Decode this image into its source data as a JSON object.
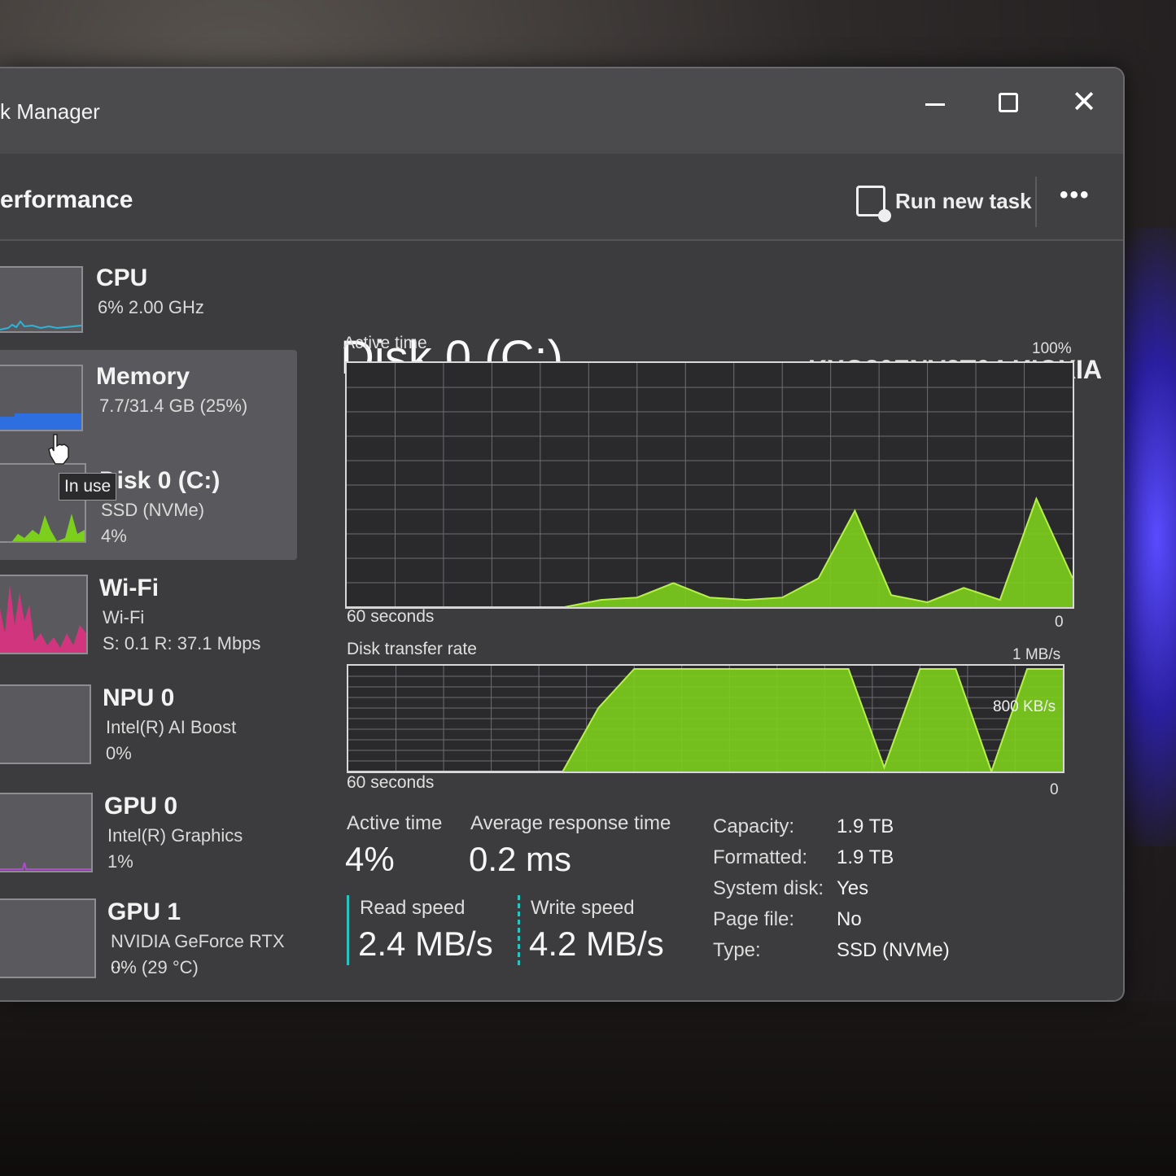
{
  "window": {
    "title": "k Manager"
  },
  "titlebar_buttons": {
    "minimize": "minimize-icon",
    "maximize": "maximize-icon",
    "close": "✕"
  },
  "command_bar": {
    "page": "erformance",
    "run_task": "Run new task",
    "more": "•••"
  },
  "sidebar": {
    "items": [
      {
        "name": "CPU",
        "line1": "6% 2.00 GHz",
        "line2": "",
        "color": "#2fb3d8"
      },
      {
        "name": "Memory",
        "line1": "7.7/31.4 GB (25%)",
        "line2": "",
        "color": "#2d6fe0"
      },
      {
        "name": "Disk 0 (C:)",
        "line1": "SSD (NVMe)",
        "line2": "4%",
        "color": "#7ccf1c"
      },
      {
        "name": "Wi-Fi",
        "line1": "Wi-Fi",
        "line2": "S: 0.1 R: 37.1 Mbps",
        "color": "#d0357d"
      },
      {
        "name": "NPU 0",
        "line1": "Intel(R) AI Boost",
        "line2": "0%",
        "color": "#3fb0d0"
      },
      {
        "name": "GPU 0",
        "line1": "Intel(R) Graphics",
        "line2": "1%",
        "color": "#b04ad0"
      },
      {
        "name": "GPU 1",
        "line1": "NVIDIA GeForce RTX ...",
        "line2": "0% (29 °C)",
        "color": "#b04ad0"
      }
    ],
    "tooltip": "In use"
  },
  "main": {
    "title": "Disk 0 (C:)",
    "model": "KXG80ZNV2T04 KIOXIA",
    "active_graph": {
      "label": "Active time",
      "max": "100%",
      "time": "60 seconds",
      "min": "0"
    },
    "transfer_graph": {
      "label": "Disk transfer rate",
      "max": "1 MB/s",
      "mid": "800 KB/s",
      "time": "60 seconds",
      "min": "0"
    },
    "stats": {
      "active_time_label": "Active time",
      "active_time": "4%",
      "response_label": "Average response time",
      "response": "0.2 ms",
      "read_label": "Read speed",
      "read": "2.4 MB/s",
      "write_label": "Write speed",
      "write": "4.2 MB/s"
    },
    "properties": [
      {
        "key": "Capacity:",
        "value": "1.9 TB"
      },
      {
        "key": "Formatted:",
        "value": "1.9 TB"
      },
      {
        "key": "System disk:",
        "value": "Yes"
      },
      {
        "key": "Page file:",
        "value": "No"
      },
      {
        "key": "Type:",
        "value": "SSD (NVMe)"
      }
    ]
  },
  "chart_data": [
    {
      "type": "area",
      "title": "Active time",
      "ylim": [
        0,
        100
      ],
      "x": [
        0,
        3,
        6,
        9,
        12,
        15,
        18,
        21,
        24,
        27,
        30,
        33,
        36,
        39,
        42,
        45,
        48,
        51,
        54,
        57,
        60
      ],
      "series": [
        {
          "values": [
            0,
            0,
            0,
            0,
            0,
            0,
            0,
            3,
            4,
            10,
            4,
            3,
            4,
            12,
            40,
            5,
            2,
            8,
            3,
            45,
            12
          ]
        }
      ]
    },
    {
      "type": "area",
      "title": "Disk transfer rate",
      "ylim": [
        0,
        1000
      ],
      "x": [
        0,
        3,
        6,
        9,
        12,
        15,
        18,
        21,
        24,
        27,
        30,
        33,
        36,
        39,
        42,
        45,
        48,
        51,
        54,
        57,
        60
      ],
      "series": [
        {
          "values": [
            0,
            0,
            0,
            0,
            0,
            0,
            0,
            620,
            1000,
            1000,
            1000,
            1000,
            1000,
            1000,
            1000,
            40,
            1000,
            1000,
            0,
            1000,
            1000
          ]
        }
      ]
    }
  ]
}
